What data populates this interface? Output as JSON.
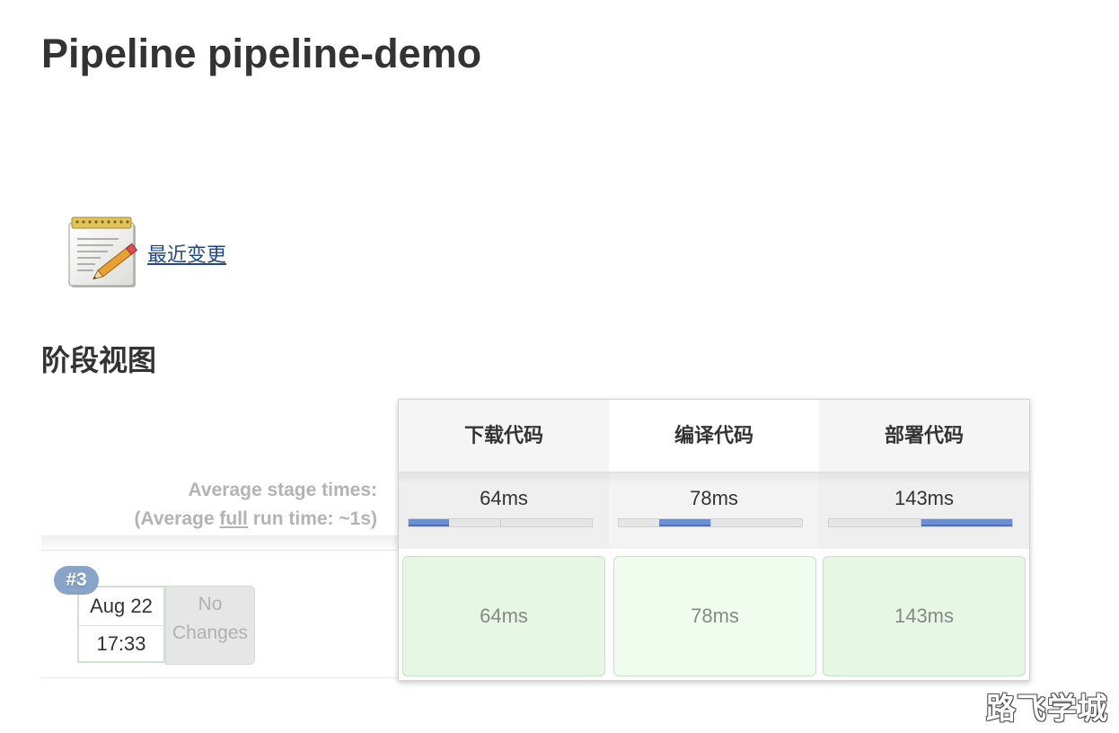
{
  "page_title": "Pipeline pipeline-demo",
  "recent_changes": {
    "icon": "notepad-icon",
    "label": "最近变更"
  },
  "stage_view": {
    "heading": "阶段视图",
    "average_label_line1": "Average stage times:",
    "average_label_line2_prefix": "(Average ",
    "average_label_line2_link": "full",
    "average_label_line2_suffix": " run time: ~1s)",
    "stages": [
      {
        "name": "下载代码",
        "average": "64ms",
        "progress": {
          "start": 0.0,
          "end": 0.22
        }
      },
      {
        "name": "编译代码",
        "average": "78ms",
        "progress": {
          "start": 0.22,
          "end": 0.5
        }
      },
      {
        "name": "部署代码",
        "average": "143ms",
        "progress": {
          "start": 0.5,
          "end": 1.0
        }
      }
    ],
    "builds": [
      {
        "number": "#3",
        "date": "Aug 22",
        "time": "17:33",
        "changes_line1": "No",
        "changes_line2": "Changes",
        "stage_durations": [
          "64ms",
          "78ms",
          "143ms"
        ]
      }
    ],
    "colors": {
      "success_cell": "#e6f8e3",
      "progress_fill": "#6c8fd4",
      "build_badge": "#8aa4c8"
    }
  },
  "watermark": "路飞学城"
}
